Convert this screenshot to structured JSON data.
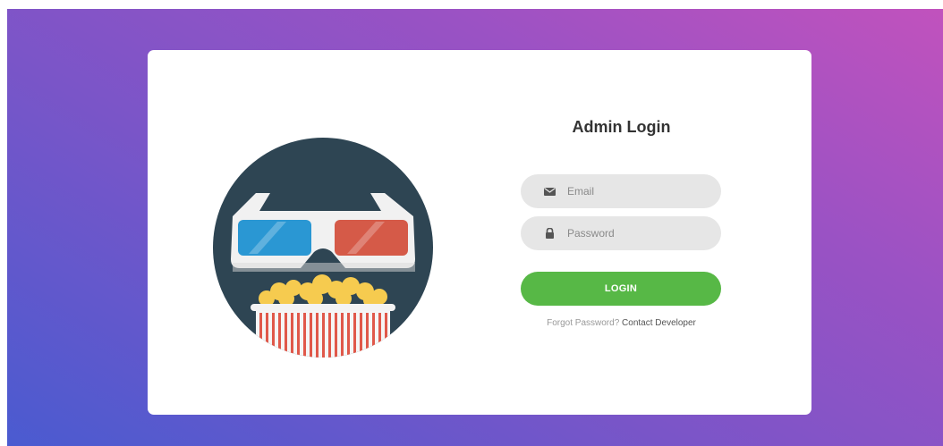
{
  "login": {
    "title": "Admin Login",
    "email_placeholder": "Email",
    "password_placeholder": "Password",
    "button_label": "LOGIN",
    "forgot_text": "Forgot Password?",
    "contact_link": "Contact Developer"
  },
  "icons": {
    "email": "envelope-icon",
    "password": "lock-icon",
    "illustration": "3d-glasses-popcorn"
  },
  "colors": {
    "gradient_start": "#4a5bd0",
    "gradient_end": "#c152bd",
    "accent_green": "#57b846",
    "circle": "#2e4553"
  }
}
